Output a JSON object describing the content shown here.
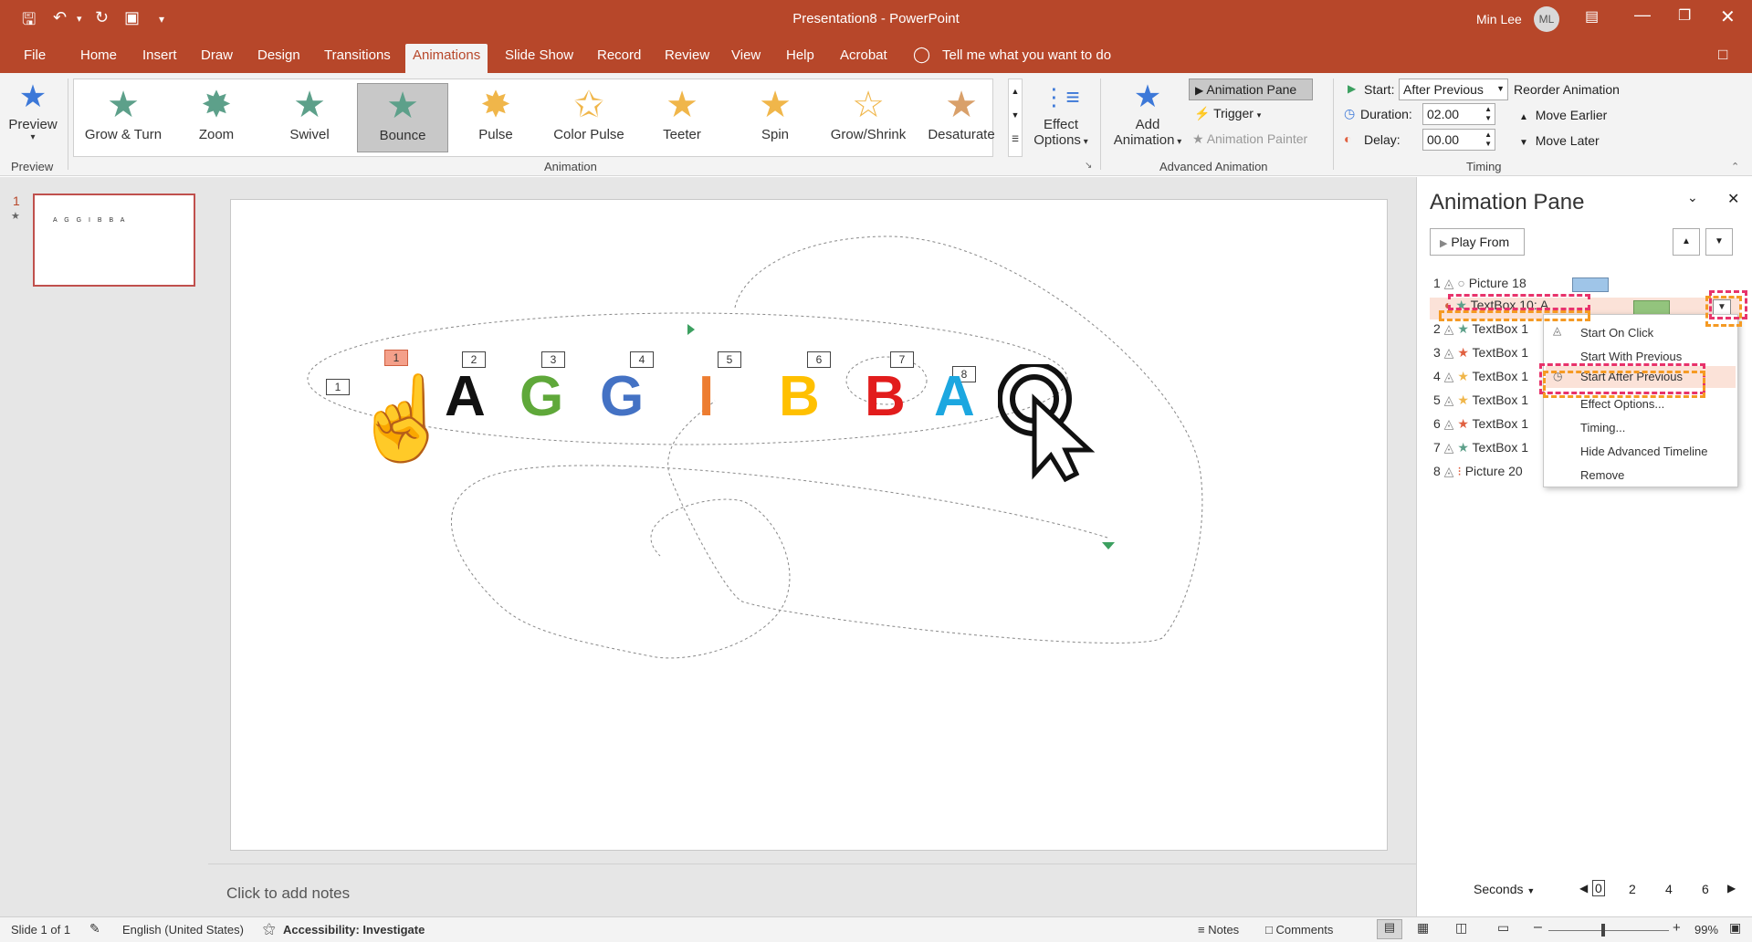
{
  "window": {
    "title": "Presentation8  -  PowerPoint",
    "user": "Min Lee",
    "user_initials": "ML"
  },
  "tabs": [
    "File",
    "Home",
    "Insert",
    "Draw",
    "Design",
    "Transitions",
    "Animations",
    "Slide Show",
    "Record",
    "Review",
    "View",
    "Help",
    "Acrobat"
  ],
  "active_tab": "Animations",
  "tell_me": "Tell me what you want to do",
  "ribbon": {
    "preview": {
      "label": "Preview",
      "group": "Preview"
    },
    "gallery": [
      "Grow & Turn",
      "Zoom",
      "Swivel",
      "Bounce",
      "Pulse",
      "Color Pulse",
      "Teeter",
      "Spin",
      "Grow/Shrink",
      "Desaturate"
    ],
    "gallery_selected": "Bounce",
    "effect_options": {
      "line1": "Effect",
      "line2": "Options"
    },
    "animation_group": "Animation",
    "add_animation": {
      "line1": "Add",
      "line2": "Animation"
    },
    "animation_pane_btn": "Animation Pane",
    "trigger": "Trigger",
    "animation_painter": "Animation Painter",
    "advanced_group": "Advanced Animation",
    "start_label": "Start:",
    "start_value": "After Previous",
    "duration_label": "Duration:",
    "duration_value": "02.00",
    "delay_label": "Delay:",
    "delay_value": "00.00",
    "reorder": "Reorder Animation",
    "move_earlier": "Move Earlier",
    "move_later": "Move Later",
    "timing_group": "Timing"
  },
  "thumb": {
    "number": "1",
    "letters": "A G G I B B A"
  },
  "slide": {
    "letters": [
      {
        "ch": "A",
        "color": "#111111"
      },
      {
        "ch": "G",
        "color": "#5fa83a"
      },
      {
        "ch": "G",
        "color": "#4472c4"
      },
      {
        "ch": "I",
        "color": "#ed7d31"
      },
      {
        "ch": "B",
        "color": "#ffc000"
      },
      {
        "ch": "B",
        "color": "#e21c1c"
      },
      {
        "ch": "A",
        "color": "#1ca7e0"
      }
    ],
    "tags": [
      "1",
      "1",
      "2",
      "3",
      "4",
      "5",
      "6",
      "7",
      "8"
    ]
  },
  "notes_placeholder": "Click to add notes",
  "animation_pane": {
    "title": "Animation Pane",
    "play_from": "Play From",
    "rows": [
      {
        "num": "1",
        "name": "Picture 18"
      },
      {
        "num": "",
        "name": "TextBox 10: A"
      },
      {
        "num": "2",
        "name": "TextBox 1"
      },
      {
        "num": "3",
        "name": "TextBox 1"
      },
      {
        "num": "4",
        "name": "TextBox 1"
      },
      {
        "num": "5",
        "name": "TextBox 1"
      },
      {
        "num": "6",
        "name": "TextBox 1"
      },
      {
        "num": "7",
        "name": "TextBox 1"
      },
      {
        "num": "8",
        "name": "Picture 20"
      }
    ],
    "seconds": "Seconds",
    "timeline": [
      "0",
      "2",
      "4",
      "6"
    ]
  },
  "context_menu": [
    "Start On Click",
    "Start With Previous",
    "Start After Previous",
    "Effect Options...",
    "Timing...",
    "Hide Advanced Timeline",
    "Remove"
  ],
  "context_menu_selected": "Start After Previous",
  "status": {
    "slide": "Slide 1 of 1",
    "language": "English (United States)",
    "accessibility": "Accessibility: Investigate",
    "notes": "Notes",
    "comments": "Comments",
    "zoom": "99%"
  }
}
